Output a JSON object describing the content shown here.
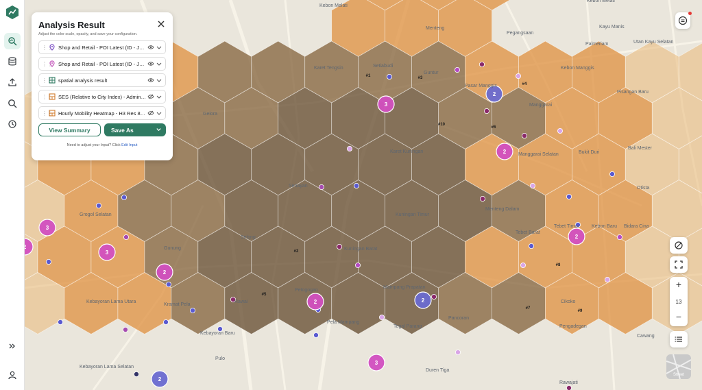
{
  "rail": {
    "items": [
      {
        "name": "logo-icon"
      },
      {
        "name": "analysis-icon"
      },
      {
        "name": "database-icon"
      },
      {
        "name": "upload-icon"
      },
      {
        "name": "search-icon"
      },
      {
        "name": "history-icon"
      },
      {
        "name": "expand-icon"
      },
      {
        "name": "user-icon"
      }
    ]
  },
  "panel": {
    "title": "Analysis Result",
    "subtitle": "Adjust the color scale, opacity, and save your configuration.",
    "layers": [
      {
        "label": "Shop and Retail - POI Latest (ID - Jakar...",
        "icon": "location-pin-icon",
        "icon_color": "#7b4fc4"
      },
      {
        "label": "Shop and Retail - POI Latest (ID - Jakar...",
        "icon": "location-pin-icon",
        "icon_color": "#c04fb8"
      },
      {
        "label": "spatial analysis result",
        "icon": "grid-icon",
        "icon_color": "#2f7a62"
      },
      {
        "label": "SES (Relative to City Index) - Admin Vill...",
        "icon": "polygon-icon",
        "icon_color": "#d07a2a"
      },
      {
        "label": "Hourly Mobility Heatmap - H3 Res 8 La...",
        "icon": "polygon-icon",
        "icon_color": "#d07a2a"
      }
    ],
    "view_summary": "View Summary",
    "save_as": "Save As",
    "hint_text": "Need to adjust your Input? Click",
    "hint_link": "Edit Input"
  },
  "map": {
    "zoom_level": "13",
    "street_label": "Street",
    "place_labels": [
      "Kebon Melati",
      "Menteng",
      "Pegangsaan",
      "Kayu Manis",
      "Palmeriam",
      "Utan Kayu Selatan",
      "Karet Tengsin",
      "Setiabudi",
      "Guntur",
      "Pasar Manggis",
      "Manggarai",
      "Bukit Duri",
      "Pisangan Baru",
      "Bali Mester",
      "Gelora",
      "Karet Kuningan",
      "Manggarai Selatan",
      "Kebon Manggis",
      "Senayan",
      "Kuningan Timur",
      "Menteng Dalam",
      "Tebet Barat",
      "Tebet Timur",
      "Kebon Baru",
      "Bidara Cina",
      "Grogol Selatan",
      "Selong",
      "Gunung",
      "Kuningan Barat",
      "Otista",
      "Mampang Prapatan",
      "Pela Mampang",
      "Kebayoran Lama Utara",
      "Kramat Pela",
      "Rawai",
      "Petogogan",
      "Cikoko",
      "Pengadegan",
      "Pancoran",
      "Kebayoran Baru",
      "Tegal Parang",
      "Cawang",
      "Pulo",
      "Duren Tiga",
      "Kebayoran Lama Selatan",
      "Rawajati",
      "Kebon Melati"
    ],
    "hex_labels": [
      "#1",
      "#2",
      "#3",
      "#4",
      "#5",
      "#6",
      "#7",
      "#8",
      "#9",
      "#10"
    ],
    "cluster_counts": [
      "3",
      "2",
      "2",
      "3",
      "3",
      "2",
      "2",
      "2",
      "2",
      "3",
      "2",
      "2"
    ]
  },
  "colors": {
    "accent": "#2f7a62",
    "hex_dark": "#6b5438",
    "hex_mid": "#8a6a45",
    "hex_orange": "#e0964a",
    "hex_light": "#eab878",
    "cluster_pink": "#d24fc0",
    "cluster_blue": "#6a6ad0"
  }
}
